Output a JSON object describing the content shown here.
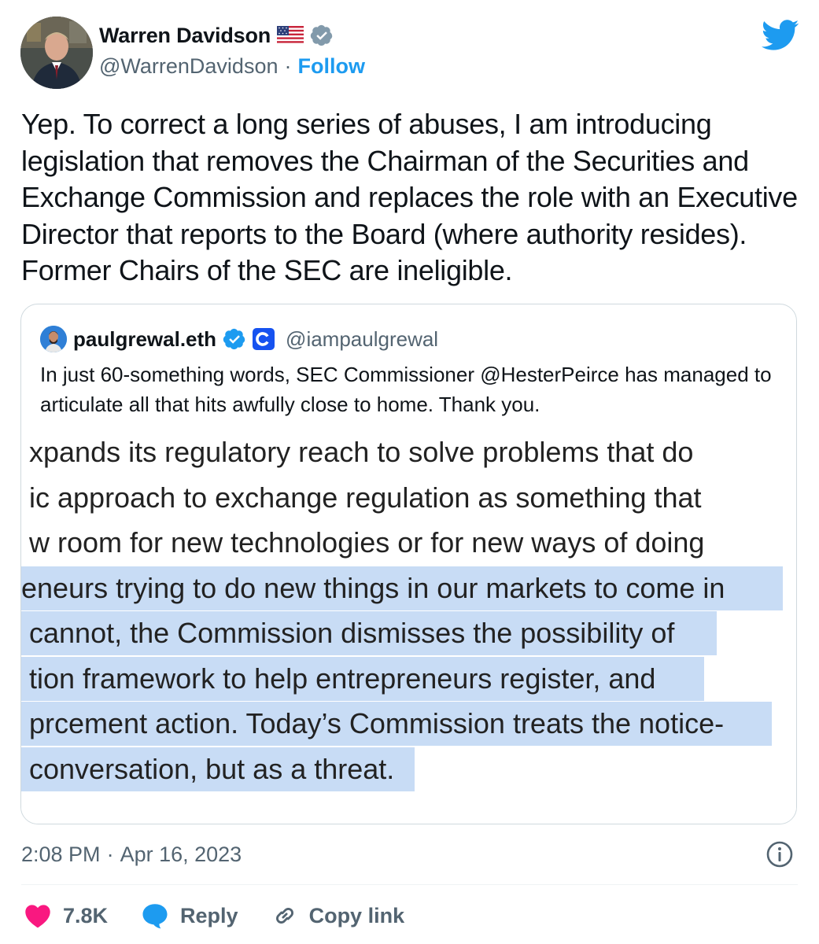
{
  "author": {
    "display_name": "Warren Davidson",
    "handle": "@WarrenDavidson",
    "follow_label": "Follow",
    "flag_icon": "us-flag-icon",
    "verified_icon": "verified-badge-icon"
  },
  "tweet_text": "Yep. To correct a long series of abuses, I am introducing legislation that removes the Chairman of the Securities and Exchange Commission and replaces the role with an Executive Director that reports to the Board (where authority resides). Former Chairs of the SEC are ineligible.",
  "quote": {
    "display_name": "paulgrewal.eth",
    "handle": "@iampaulgrewal",
    "text": "In just 60-something words, SEC Commissioner @HesterPeirce has managed to articulate all that hits awfully close to home. Thank you.",
    "image_lines": [
      {
        "text": " xpands its regulatory reach to solve problems that do",
        "highlighted": false
      },
      {
        "text": " ic approach to exchange regulation as something that",
        "highlighted": false
      },
      {
        "text": " w room for new technologies or for new ways of doing",
        "highlighted": false
      },
      {
        "text": "eneurs trying to do new things in our markets to come in",
        "highlighted": true
      },
      {
        "text": " cannot, the Commission dismisses the possibility of",
        "highlighted": true
      },
      {
        "text": " tion framework to help entrepreneurs register, and",
        "highlighted": true
      },
      {
        "text": " prcement action. Today’s Commission treats the notice-",
        "highlighted": true
      },
      {
        "text": " conversation, but as a threat.",
        "highlighted": true
      }
    ]
  },
  "timestamp": {
    "time": "2:08 PM",
    "separator": "·",
    "date": "Apr 16, 2023"
  },
  "actions": {
    "likes": "7.8K",
    "reply_label": "Reply",
    "copy_link_label": "Copy link"
  },
  "colors": {
    "accent": "#1d9bf0",
    "like": "#f91880",
    "highlight": "#c8dcf5"
  }
}
